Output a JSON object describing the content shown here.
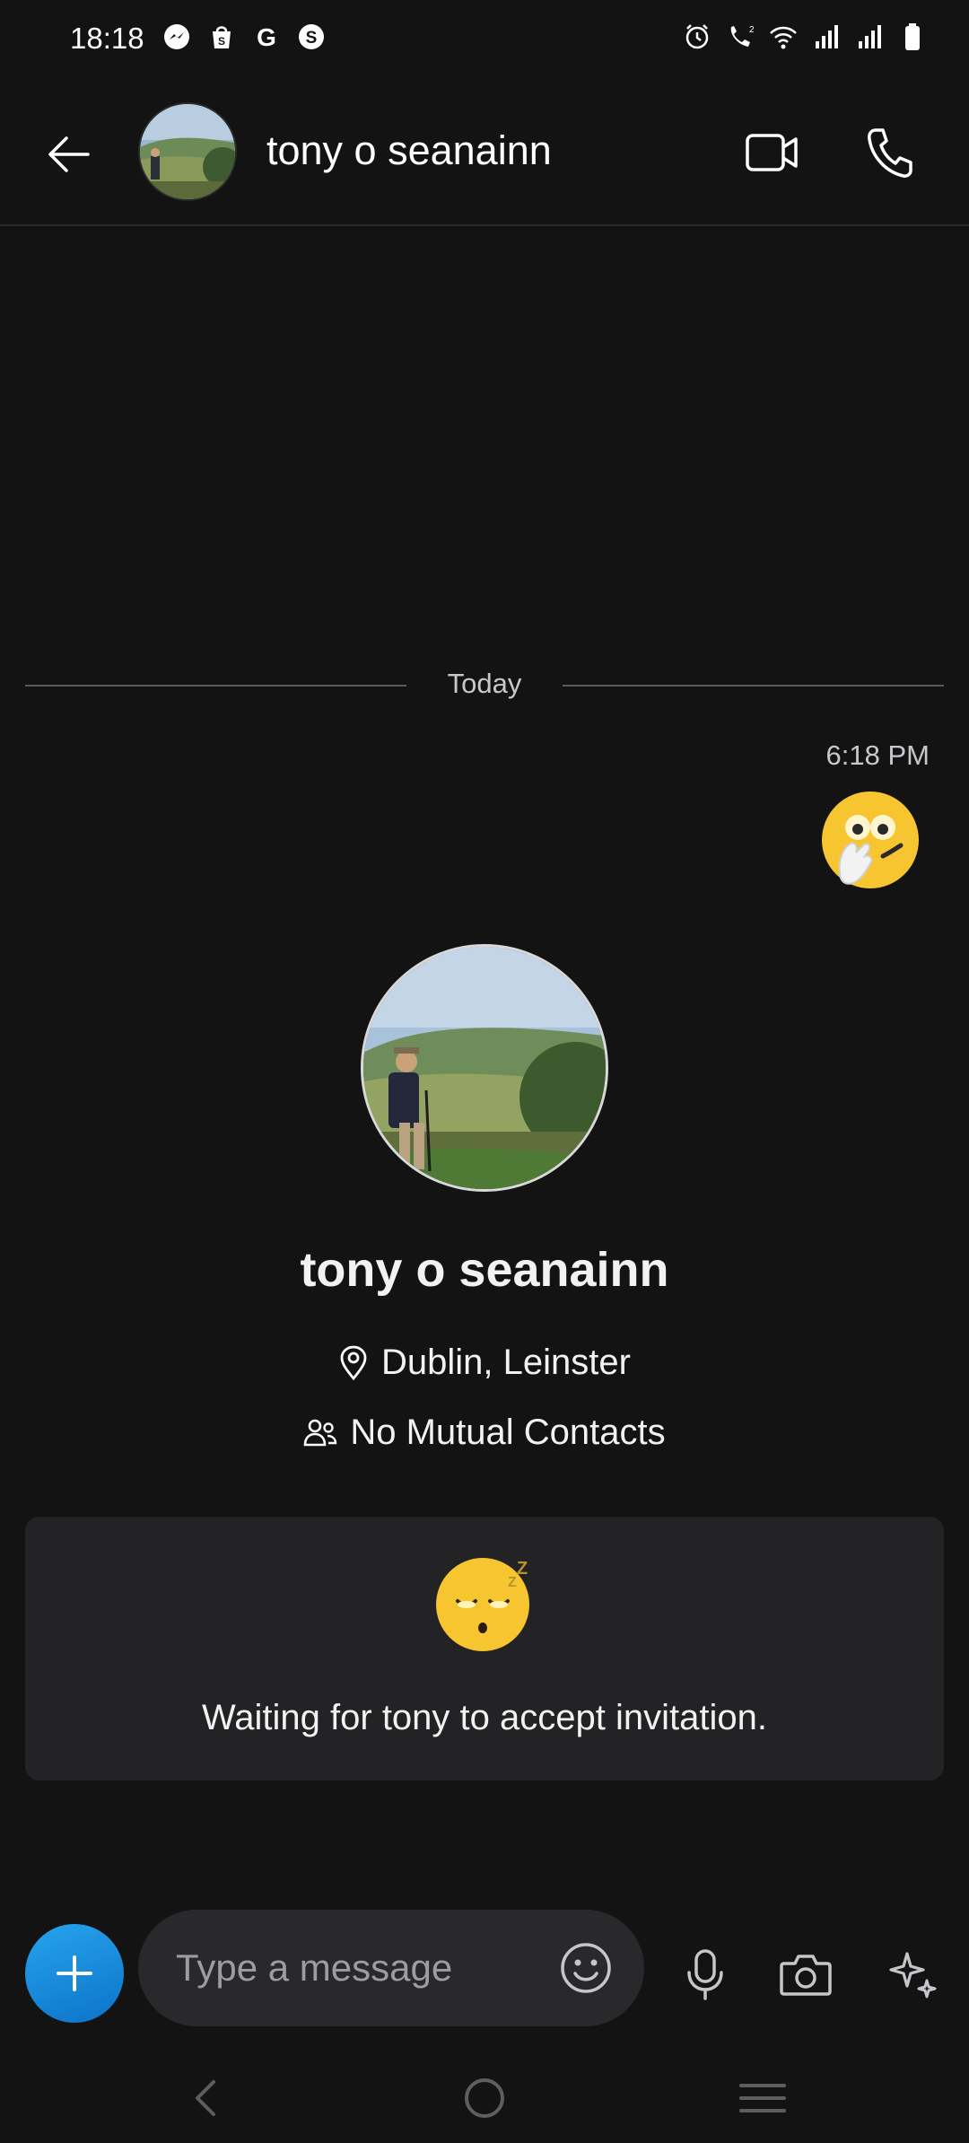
{
  "status_bar": {
    "time": "18:18",
    "left_icons": [
      "messenger-icon",
      "shopping-bag-icon",
      "google-icon",
      "skype-icon"
    ],
    "right_icons": [
      "alarm-icon",
      "wifi-call-icon",
      "wifi-icon",
      "signal-icon",
      "signal-icon",
      "battery-icon"
    ]
  },
  "header": {
    "contact_name": "tony o seanainn",
    "back_icon": "arrow-left-icon",
    "video_icon": "video-camera-icon",
    "call_icon": "phone-icon"
  },
  "conversation": {
    "date_divider": "Today",
    "messages": [
      {
        "time": "6:18 PM",
        "content": "hand-over-mouth-emoji",
        "sender": "me"
      }
    ]
  },
  "profile": {
    "name": "tony o seanainn",
    "location": "Dublin, Leinster",
    "mutual_contacts": "No Mutual Contacts"
  },
  "invite": {
    "emoji": "sleeping-emoji",
    "text": "Waiting for tony to accept invitation."
  },
  "composer": {
    "placeholder": "Type a message",
    "value": ""
  },
  "colors": {
    "background": "#131314",
    "accent": "#1a8ad8",
    "card": "#232325",
    "input": "#29292c"
  }
}
